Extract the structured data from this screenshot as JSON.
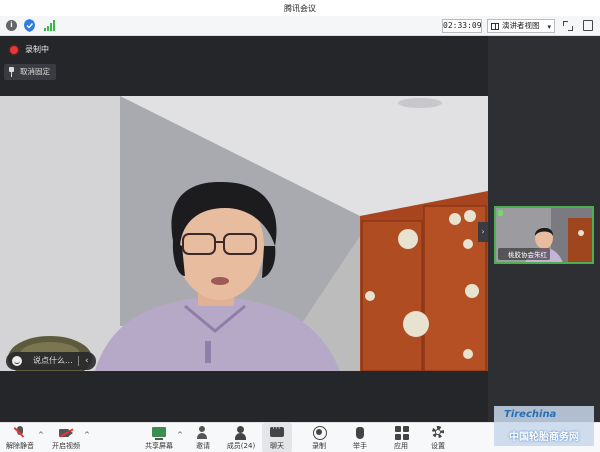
{
  "window": {
    "title": "腾讯会议"
  },
  "toolbar": {
    "timer": "02:33:09",
    "view_label": "演讲者视图",
    "view_caret": "▾"
  },
  "stage": {
    "recording_label": "录制中",
    "unpin_label": "取消固定",
    "chat_placeholder": "说点什么...",
    "chat_collapse": "‹",
    "side_toggle": "›"
  },
  "participants": [
    {
      "name": "桃胶协会朱红"
    }
  ],
  "bottom_bar": {
    "buttons": [
      {
        "label": "解除静音"
      },
      {
        "label": "开启视频"
      },
      {
        "label": "共享屏幕"
      },
      {
        "label": "邀请"
      },
      {
        "label": "成员(24)"
      },
      {
        "label": "聊天"
      },
      {
        "label": "录制"
      },
      {
        "label": "举手"
      },
      {
        "label": "应用"
      },
      {
        "label": "设置"
      }
    ],
    "caret": "^"
  },
  "watermark": {
    "brand": "Tirechina",
    "text": "中国轮胎商务网"
  },
  "colors": {
    "stage_bg": "#24262a",
    "recording_dot": "#e53935",
    "active_speaker_border": "#4caf50",
    "signal": "#3ab54a",
    "share_icon": "#3b8e4f"
  }
}
